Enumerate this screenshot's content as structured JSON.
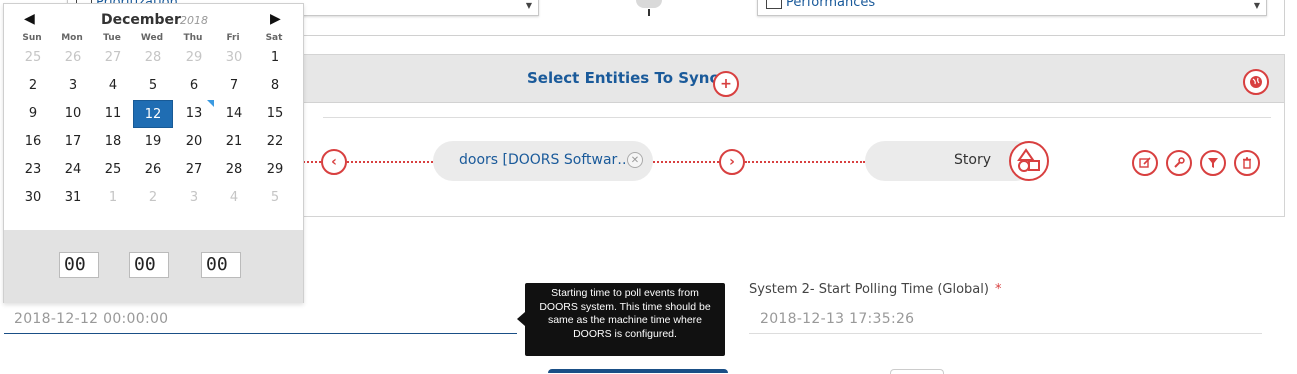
{
  "top": {
    "left_select_text": "Prioritization",
    "right_select_text": "Performances"
  },
  "calendar": {
    "month": "December",
    "year": "2018",
    "weekdays": [
      "Sun",
      "Mon",
      "Tue",
      "Wed",
      "Thu",
      "Fri",
      "Sat"
    ],
    "weeks": [
      [
        "25",
        "26",
        "27",
        "28",
        "29",
        "30",
        "1"
      ],
      [
        "2",
        "3",
        "4",
        "5",
        "6",
        "7",
        "8"
      ],
      [
        "9",
        "10",
        "11",
        "12",
        "13",
        "14",
        "15"
      ],
      [
        "16",
        "17",
        "18",
        "19",
        "20",
        "21",
        "22"
      ],
      [
        "23",
        "24",
        "25",
        "26",
        "27",
        "28",
        "29"
      ],
      [
        "30",
        "31",
        "1",
        "2",
        "3",
        "4",
        "5"
      ]
    ],
    "selected_day": "12",
    "today_day": "13",
    "time": {
      "hours": "00",
      "minutes": "00",
      "seconds": "00"
    }
  },
  "panel": {
    "title": "Select Entities To Sync",
    "left_entity": "doors [DOORS Softwar…",
    "right_entity": "Story"
  },
  "fields": {
    "system1_value": "2018-12-12 00:00:00",
    "system2_label": "System 2- Start Polling Time (Global)",
    "system2_required": "*",
    "system2_value": "2018-12-13 17:35:26"
  },
  "tooltip": {
    "text": "Starting time to poll events from DOORS system. This time should be same as the machine time where DOORS is configured."
  },
  "colors": {
    "accent_red": "#d84040",
    "brand_blue": "#1a5a9a",
    "selected_blue": "#1f6db3"
  }
}
